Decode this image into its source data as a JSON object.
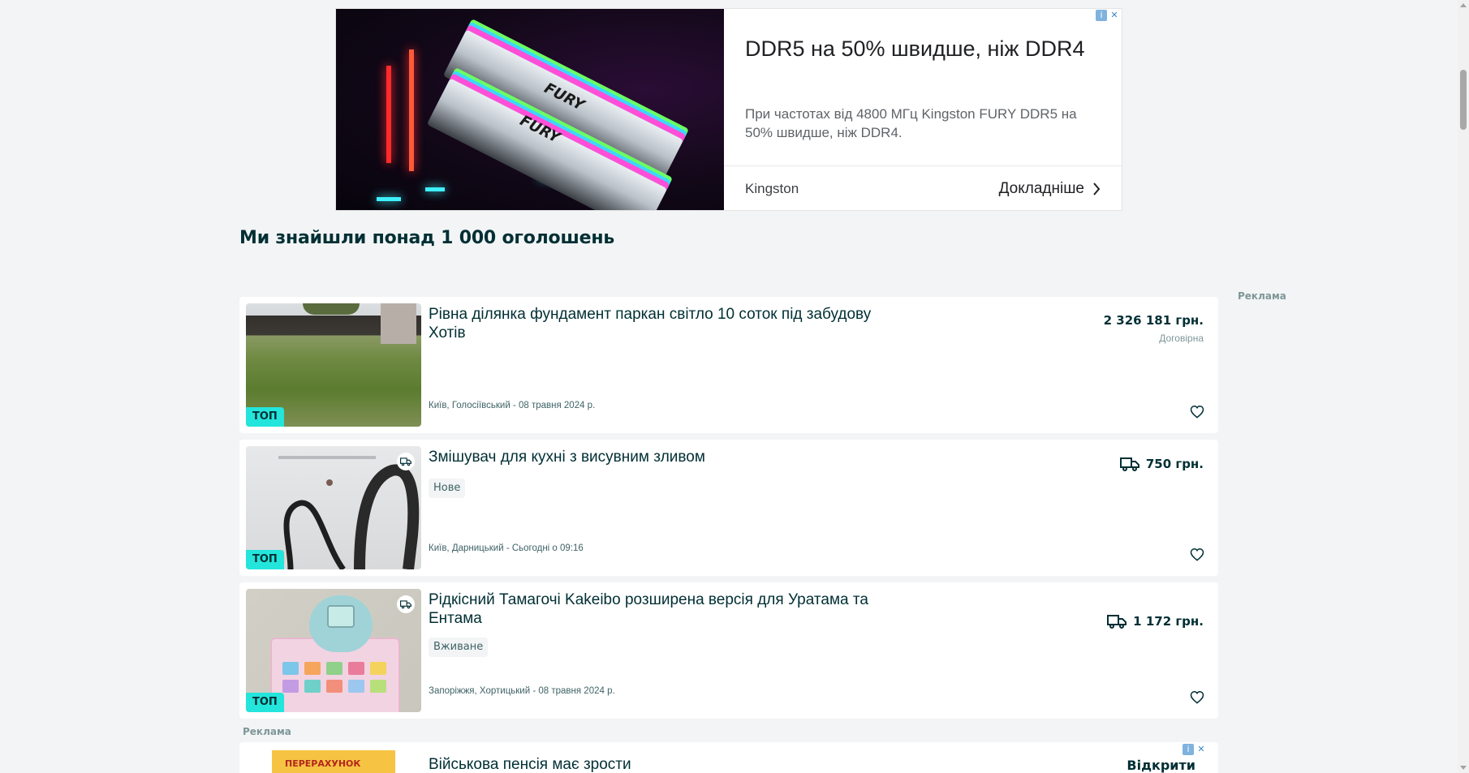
{
  "top_ad": {
    "headline": "DDR5 на 50% швидше, ніж DDR4",
    "description": "При частотах від 4800 МГц Kingston FURY DDR5 на 50% швидше, ніж DDR4.",
    "brand": "Kingston",
    "cta": "Докладніше",
    "image_text": "FURY",
    "adchoices_icon": "info-icon",
    "close_icon": "close-icon"
  },
  "results": {
    "title": "Ми знайшли понад 1 000 оголошень",
    "side_ad_label": "Реклама"
  },
  "listings": [
    {
      "title": "Рівна ділянка фундамент паркан світло 10 соток під забудову Хотів",
      "condition": "",
      "location_date": "Київ, Голосіївський - 08 травня 2024 р.",
      "price": "2 326 181 грн.",
      "price_note": "Договірна",
      "badge": "ТОП",
      "delivery": false
    },
    {
      "title": "Змішувач для кухні з висувним зливом",
      "condition": "Нове",
      "location_date": "Київ, Дарницький - Сьогодні о 09:16",
      "price": "750 грн.",
      "price_note": "",
      "badge": "ТОП",
      "delivery": true
    },
    {
      "title": "Рідкісний Тамагочі Kakeibo розширена версія для Уратама та Ентама",
      "condition": "Вживане",
      "location_date": "Запоріжжя, Хортицький - 08 травня 2024 р.",
      "price": "1 172 грн.",
      "price_note": "",
      "badge": "ТОП",
      "delivery": true
    }
  ],
  "bottom_ad": {
    "label": "Реклама",
    "image_text": "ПЕРЕРАХУНОК",
    "title": "Військова пенсія має зрости",
    "cta": "Відкрити"
  },
  "colors": {
    "page_bg": "#f2f4f5",
    "text_primary": "#002f34",
    "top_badge": "#23e5db"
  }
}
